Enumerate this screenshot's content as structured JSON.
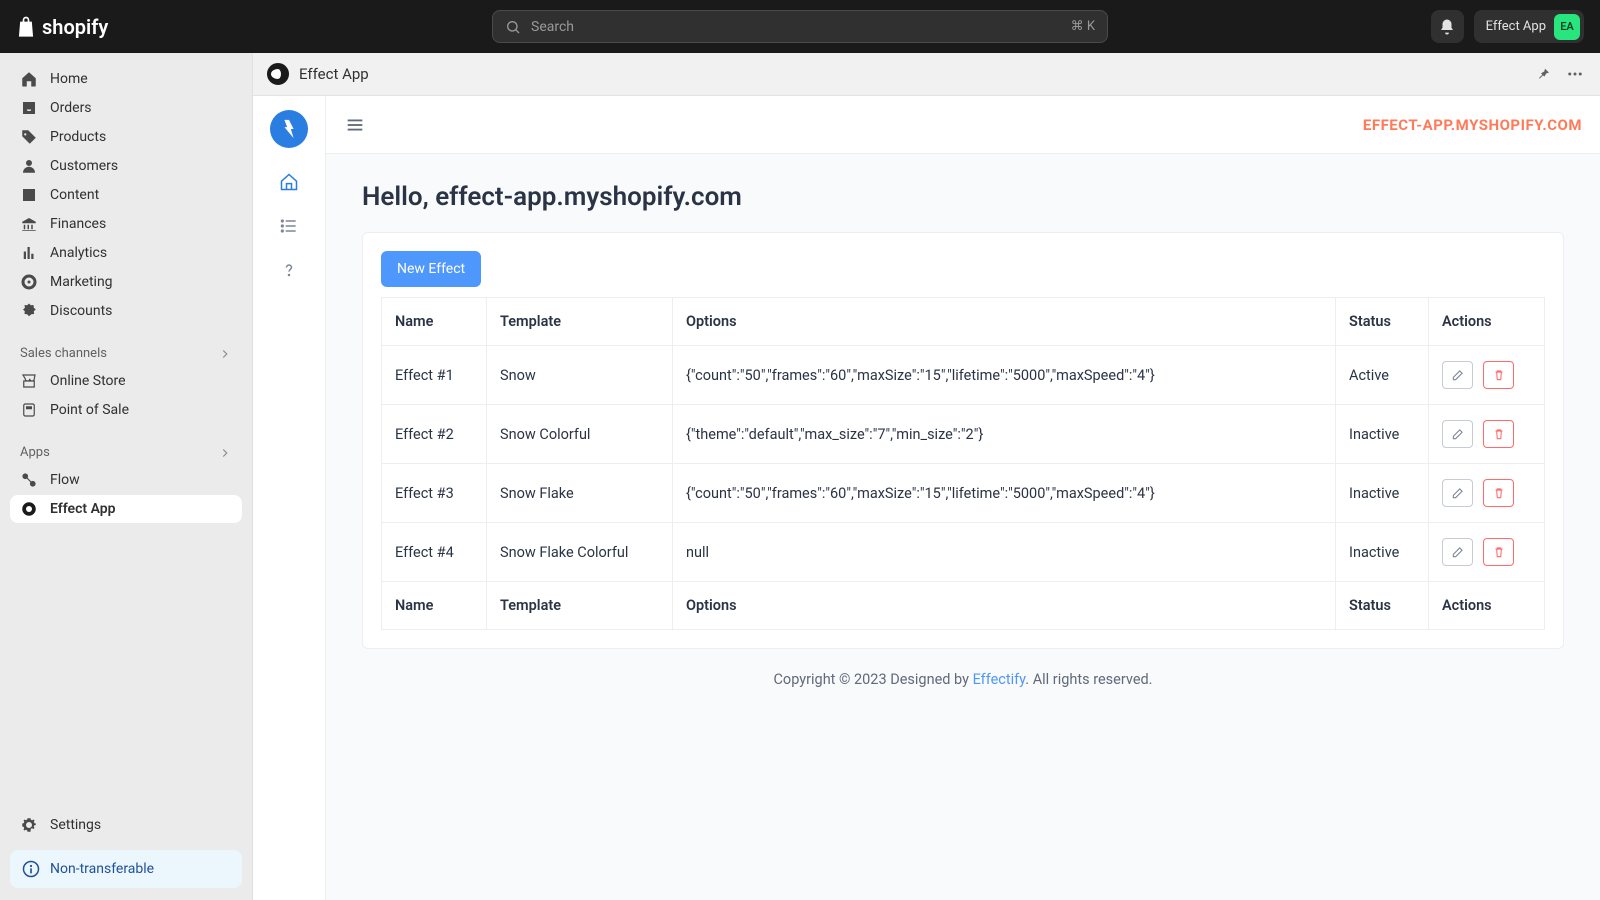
{
  "topbar": {
    "brand": "shopify",
    "search_placeholder": "Search",
    "search_kbd": "⌘ K",
    "store_name": "Effect App",
    "store_initials": "EA"
  },
  "sidebar": {
    "items": [
      {
        "label": "Home"
      },
      {
        "label": "Orders"
      },
      {
        "label": "Products"
      },
      {
        "label": "Customers"
      },
      {
        "label": "Content"
      },
      {
        "label": "Finances"
      },
      {
        "label": "Analytics"
      },
      {
        "label": "Marketing"
      },
      {
        "label": "Discounts"
      }
    ],
    "sections": {
      "sales": "Sales channels",
      "apps": "Apps"
    },
    "channel_items": [
      {
        "label": "Online Store"
      },
      {
        "label": "Point of Sale"
      }
    ],
    "app_items": [
      {
        "label": "Flow"
      },
      {
        "label": "Effect App"
      }
    ],
    "settings": "Settings",
    "info": "Non-transferable"
  },
  "app_bar": {
    "title": "Effect App"
  },
  "embedded": {
    "shop_link": "EFFECT-APP.MYSHOPIFY.COM",
    "greeting": "Hello, effect-app.myshopify.com",
    "new_button": "New Effect",
    "columns": {
      "name": "Name",
      "template": "Template",
      "options": "Options",
      "status": "Status",
      "actions": "Actions"
    },
    "rows": [
      {
        "name": "Effect #1",
        "template": "Snow",
        "options": "{\"count\":\"50\",\"frames\":\"60\",\"maxSize\":\"15\",\"lifetime\":\"5000\",\"maxSpeed\":\"4\"}",
        "status": "Active"
      },
      {
        "name": "Effect #2",
        "template": "Snow Colorful",
        "options": "{\"theme\":\"default\",\"max_size\":\"7\",\"min_size\":\"2\"}",
        "status": "Inactive"
      },
      {
        "name": "Effect #3",
        "template": "Snow Flake",
        "options": "{\"count\":\"50\",\"frames\":\"60\",\"maxSize\":\"15\",\"lifetime\":\"5000\",\"maxSpeed\":\"4\"}",
        "status": "Inactive"
      },
      {
        "name": "Effect #4",
        "template": "Snow Flake Colorful",
        "options": "null",
        "status": "Inactive"
      }
    ],
    "footer_pre": "Copyright © 2023 Designed by ",
    "footer_link": "Effectify",
    "footer_post": ". All rights reserved."
  }
}
